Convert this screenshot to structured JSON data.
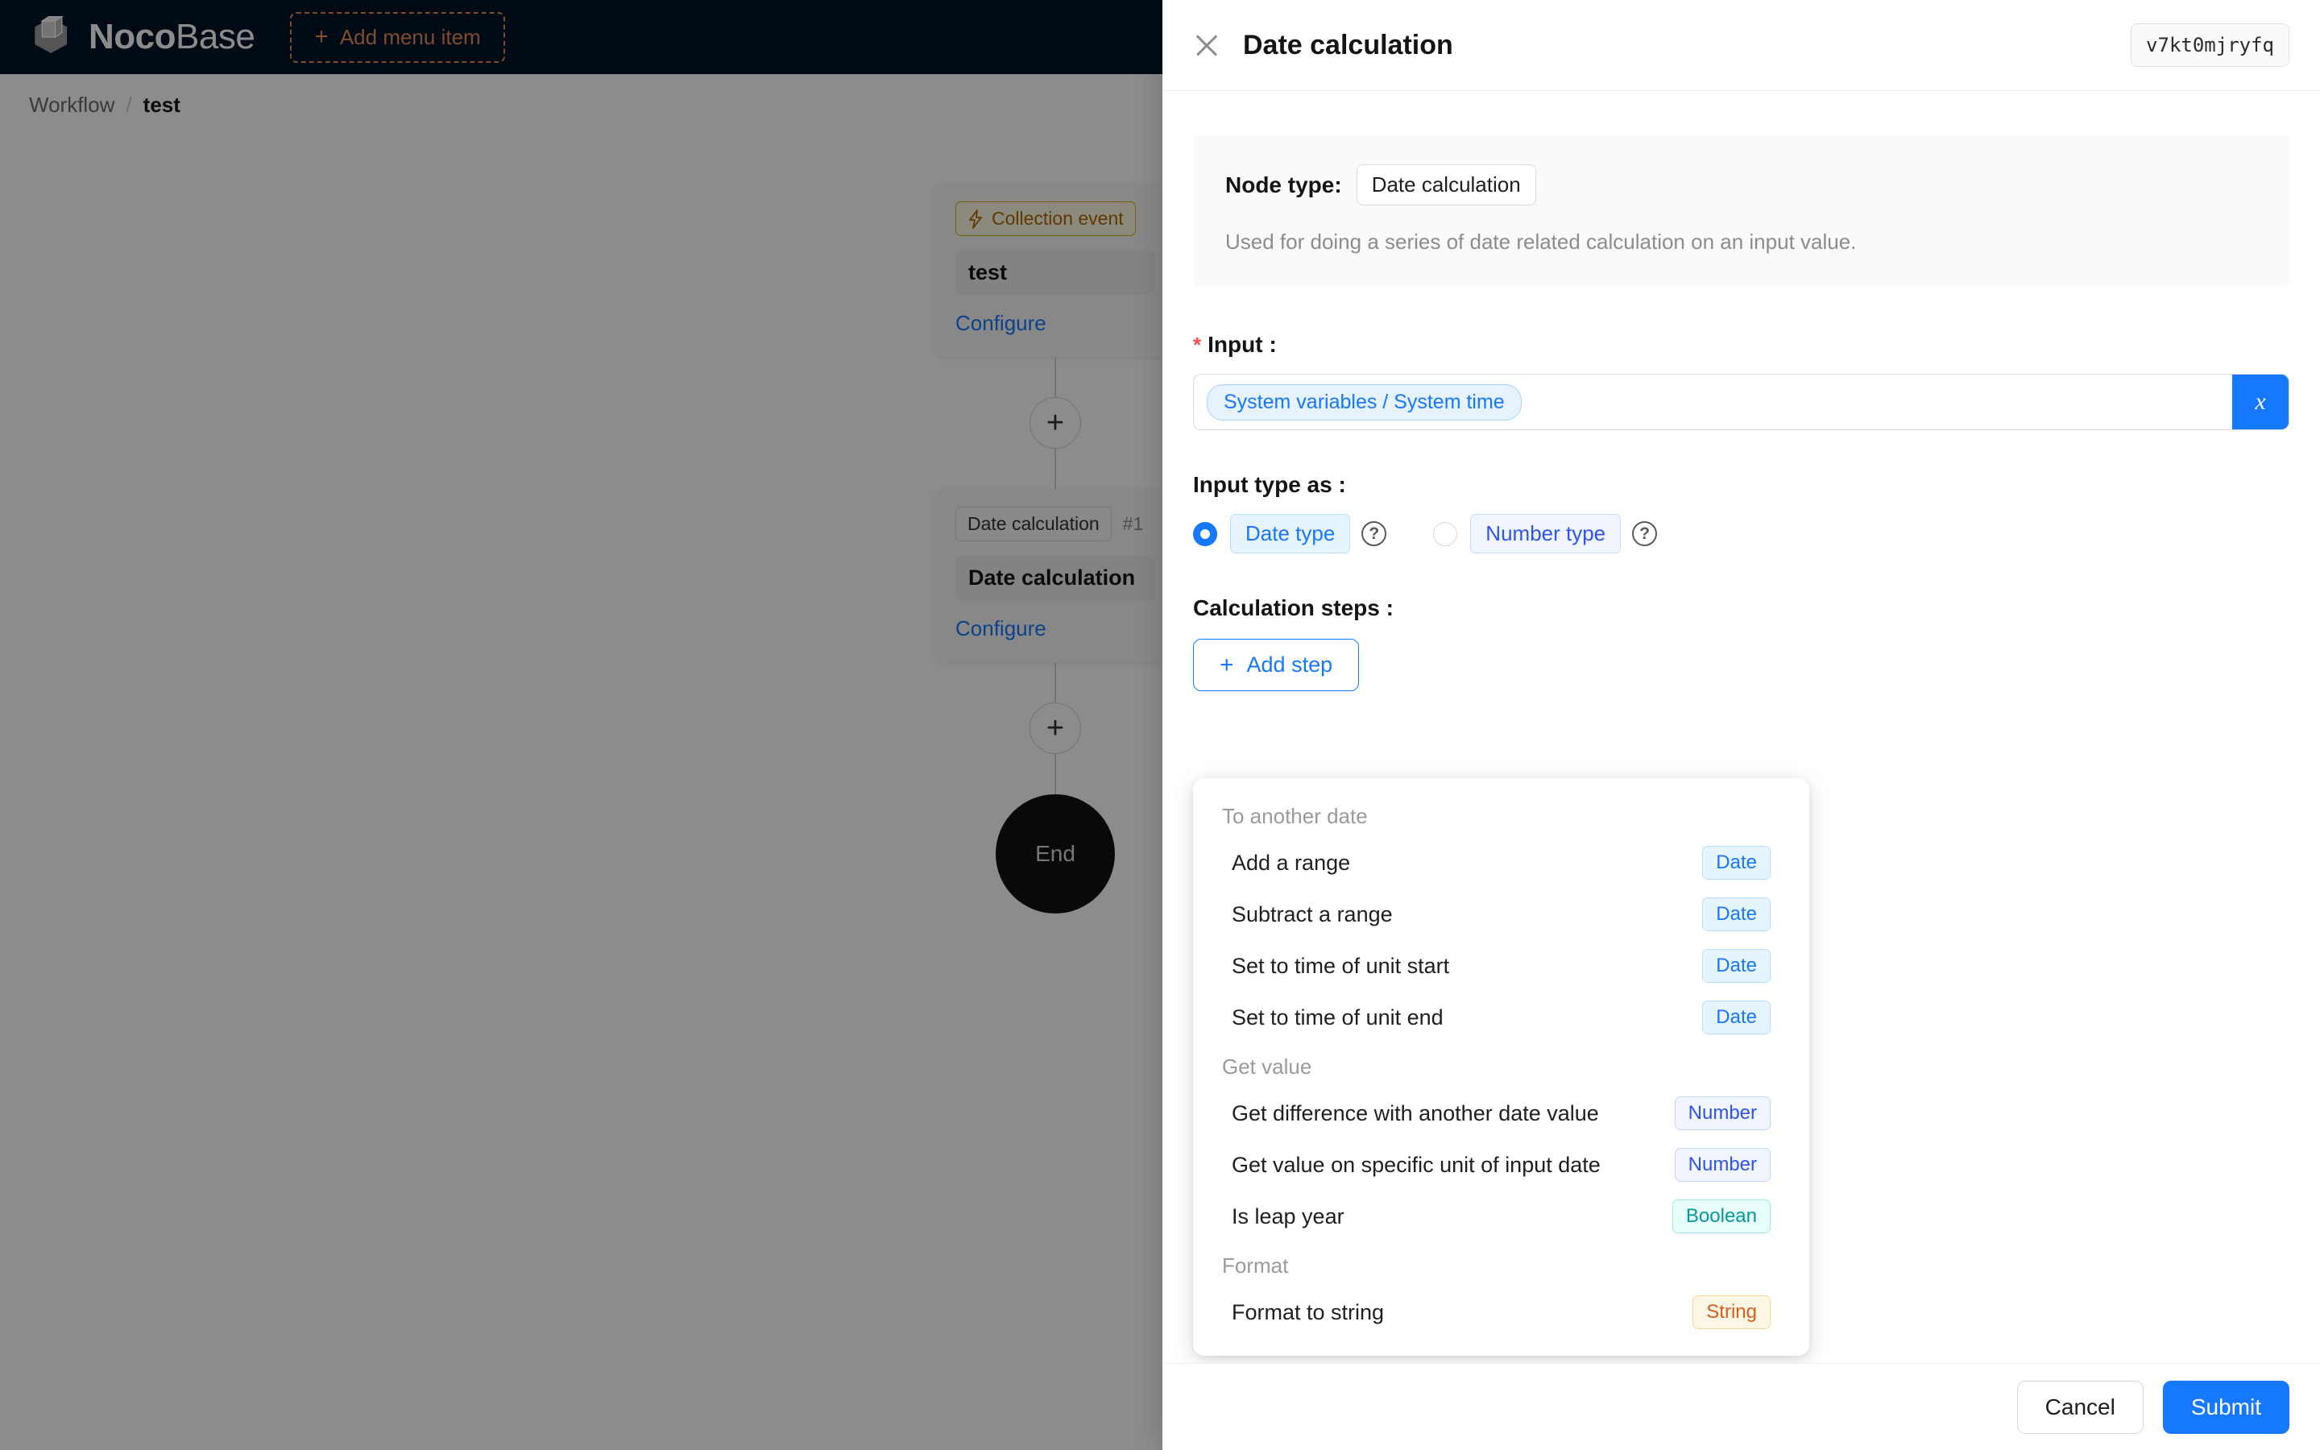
{
  "background": {
    "brand": {
      "noco": "Noco",
      "base": "Base",
      "logo_icon": "nocobase-cube-logo"
    },
    "add_menu_item": "Add menu item",
    "breadcrumb": {
      "root": "Workflow",
      "separator": "/",
      "current": "test"
    },
    "flow": {
      "nodes": [
        {
          "tag": "Collection event",
          "tag_icon": "lightning-icon",
          "index": "",
          "title": "test",
          "configure": "Configure"
        },
        {
          "tag": "Date calculation",
          "tag_icon": "",
          "index": "#1",
          "title": "Date calculation",
          "configure": "Configure"
        }
      ],
      "add_node_label": "+",
      "end_label": "End"
    }
  },
  "drawer": {
    "close_icon": "close-icon",
    "title": "Date calculation",
    "node_id": "v7kt0mjryfq",
    "info": {
      "node_type_label": "Node type:",
      "node_type_value": "Date calculation",
      "description": "Used for doing a series of date related calculation on an input value."
    },
    "input": {
      "label": "Input",
      "label_suffix": ":",
      "required_mark": "*",
      "variable_tag": "System variables / System time",
      "variable_button_icon": "x-variable-icon",
      "variable_button_label": "x"
    },
    "input_type": {
      "label": "Input type as :",
      "options": [
        {
          "label": "Date type",
          "checked": true,
          "help_icon": "question-circle-icon"
        },
        {
          "label": "Number type",
          "checked": false,
          "help_icon": "question-circle-icon"
        }
      ]
    },
    "steps": {
      "label": "Calculation steps :",
      "add_button": "Add step",
      "add_button_icon": "plus-icon"
    },
    "dropdown": {
      "groups": [
        {
          "title": "To another date",
          "items": [
            {
              "label": "Add a range",
              "badge": "Date",
              "badge_type": "date"
            },
            {
              "label": "Subtract a range",
              "badge": "Date",
              "badge_type": "date"
            },
            {
              "label": "Set to time of unit start",
              "badge": "Date",
              "badge_type": "date"
            },
            {
              "label": "Set to time of unit end",
              "badge": "Date",
              "badge_type": "date"
            }
          ]
        },
        {
          "title": "Get value",
          "items": [
            {
              "label": "Get difference with another date value",
              "badge": "Number",
              "badge_type": "number"
            },
            {
              "label": "Get value on specific unit of input date",
              "badge": "Number",
              "badge_type": "number"
            },
            {
              "label": "Is leap year",
              "badge": "Boolean",
              "badge_type": "boolean"
            }
          ]
        },
        {
          "title": "Format",
          "items": [
            {
              "label": "Format to string",
              "badge": "String",
              "badge_type": "string"
            }
          ]
        }
      ]
    },
    "footer": {
      "cancel": "Cancel",
      "submit": "Submit"
    }
  },
  "colors": {
    "primary": "#1677ff",
    "topbar_bg": "#001529",
    "accent_dashed": "#e98b5a",
    "trigger_tag": "#ad6800",
    "required": "#ff4d4f",
    "badge_date": "#1677ff",
    "badge_number": "#2f54eb",
    "badge_boolean": "#08979c",
    "badge_string": "#d4601a"
  }
}
